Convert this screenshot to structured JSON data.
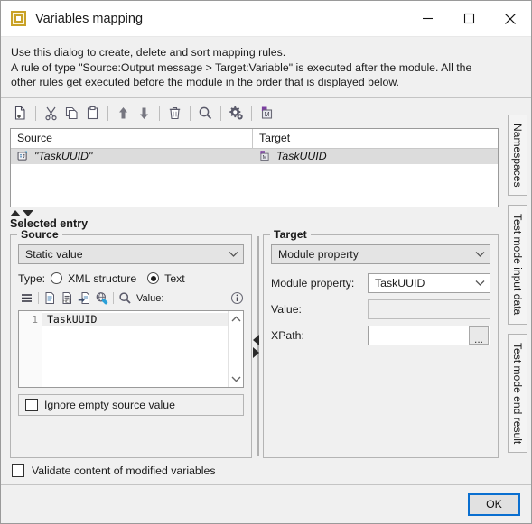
{
  "window": {
    "title": "Variables mapping",
    "icon": "variables-mapping-icon",
    "minimize_label": "─",
    "maximize_label": "□",
    "close_label": "✕"
  },
  "description": {
    "line1": "Use this dialog to create, delete and sort mapping rules.",
    "line2": "A rule of type \"Source:Output message > Target:Variable\" is executed after the module. All the",
    "line3": "other rules get executed before the module in the order that is displayed below."
  },
  "toolbar": {
    "items": [
      {
        "name": "new-rule-icon",
        "title": "New"
      },
      {
        "name": "cut-icon",
        "title": "Cut"
      },
      {
        "name": "copy-icon",
        "title": "Copy"
      },
      {
        "name": "paste-icon",
        "title": "Paste"
      },
      {
        "name": "move-up-icon",
        "title": "Move up"
      },
      {
        "name": "move-down-icon",
        "title": "Move down"
      },
      {
        "name": "delete-icon",
        "title": "Delete"
      },
      {
        "name": "search-icon",
        "title": "Search"
      },
      {
        "name": "settings-icon",
        "title": "Settings"
      },
      {
        "name": "module-property-icon",
        "title": "Module property"
      }
    ]
  },
  "rules_table": {
    "columns": [
      "Source",
      "Target"
    ],
    "rows": [
      {
        "source_icon": "static-value-icon",
        "source": "\"TaskUUID\"",
        "target_icon": "module-property-icon",
        "target": "TaskUUID"
      }
    ]
  },
  "splitter": {
    "collapse_up": "collapse-up-arrow",
    "collapse_down": "collapse-down-arrow",
    "collapse_left": "collapse-left-arrow",
    "collapse_right": "collapse-right-arrow"
  },
  "selected_entry": {
    "legend": "Selected entry",
    "source": {
      "legend": "Source",
      "type_dropdown": "Static value",
      "type_label": "Type:",
      "radio_xml": "XML structure",
      "radio_text": "Text",
      "radio_selected": "Text",
      "value_label": "Value:",
      "mini_toolbar": [
        {
          "name": "wrap-lines-icon"
        },
        {
          "name": "plain-text-icon"
        },
        {
          "name": "hex-view-icon"
        },
        {
          "name": "import-file-icon"
        },
        {
          "name": "url-link-icon"
        },
        {
          "name": "find-icon"
        }
      ],
      "info_icon": "info-icon",
      "editor": {
        "line_number": "1",
        "text": "TaskUUID",
        "scroll_up": "scroll-up-arrow",
        "scroll_down": "scroll-down-arrow"
      },
      "ignore_empty_label": "Ignore empty source value",
      "ignore_empty_checked": false
    },
    "target": {
      "legend": "Target",
      "type_dropdown": "Module property",
      "module_property_label": "Module property:",
      "module_property_value": "TaskUUID",
      "value_label": "Value:",
      "value_text": "",
      "xpath_label": "XPath:",
      "xpath_text": "",
      "browse_label": "..."
    }
  },
  "validate_checkbox": {
    "label": "Validate content of modified variables",
    "checked": false
  },
  "side_tabs": [
    {
      "label": "Namespaces",
      "name": "tab-namespaces"
    },
    {
      "label": "Test mode input data",
      "name": "tab-test-mode-input-data"
    },
    {
      "label": "Test mode end result",
      "name": "tab-test-mode-end-result"
    }
  ],
  "footer": {
    "ok_label": "OK"
  },
  "colors": {
    "accent": "#0a6fd0",
    "title_icon": "#c9a227",
    "selection": "#dcdcdc",
    "flag": "#7b3fa0"
  }
}
